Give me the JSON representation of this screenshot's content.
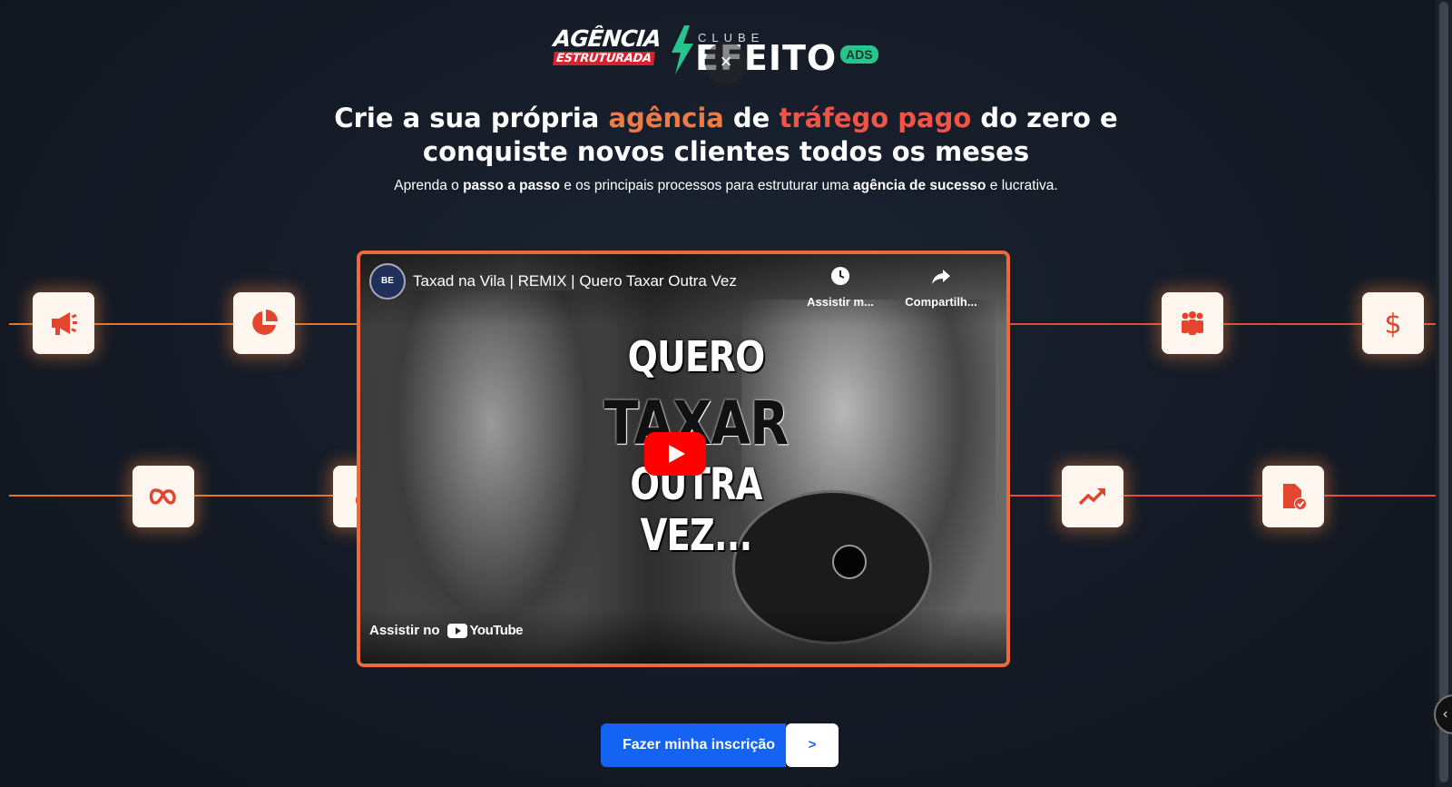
{
  "header": {
    "logo_agencia_line1": "AGÊNCIA",
    "logo_agencia_line2": "ESTRUTURADA",
    "logo_clube": "CLUBE",
    "logo_efeito": "EFEITO",
    "logo_ads": "ADS",
    "close_symbol": "×"
  },
  "hero": {
    "headline": {
      "part1": "Crie a sua própria ",
      "part2": "agência",
      "part3": " de ",
      "part4": "tráfego pago",
      "part5": " do zero e",
      "line2": "conquiste novos clientes todos os meses"
    },
    "sub": {
      "a": "Aprenda o ",
      "b": "passo a passo",
      "c": " e os principais processos para estruturar uma ",
      "d": "agência de sucesso",
      "e": " e lucrativa."
    }
  },
  "icons": {
    "left_top": [
      "megaphone-icon",
      "pie-chart-icon"
    ],
    "left_bottom": [
      "meta-infinity-icon",
      "flame-icon"
    ],
    "right_top": [
      "people-group-icon",
      "dollar-icon"
    ],
    "right_bottom": [
      "trending-up-icon",
      "document-check-icon"
    ]
  },
  "video": {
    "channel_initials": "BE",
    "title": "Taxad na Vila | REMIX | Quero Taxar Outra Vez",
    "watch_later_label": "Assistir m...",
    "share_label": "Compartilh...",
    "thumb_text_1": "QUERO",
    "thumb_text_2": "TAXAR",
    "thumb_text_3": "OUTRA VEZ...",
    "watch_on": "Assistir no",
    "youtube_brand": "YouTube"
  },
  "cta": {
    "label": "Fazer minha inscrição",
    "arrow": ">"
  },
  "colors": {
    "accent_orange": "#ee7a45",
    "accent_red": "#f05548",
    "cta_blue": "#1463f3",
    "background": "#141a25"
  }
}
